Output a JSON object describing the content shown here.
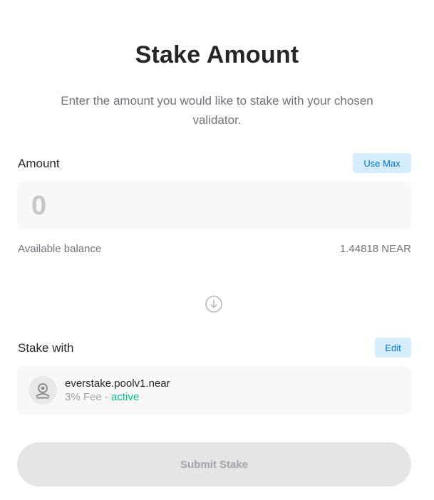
{
  "header": {
    "title": "Stake Amount",
    "subtitle": "Enter the amount you would like to stake with your chosen validator."
  },
  "amount": {
    "label": "Amount",
    "use_max_label": "Use Max",
    "placeholder": "0",
    "value": ""
  },
  "balance": {
    "label": "Available balance",
    "value": "1.44818 NEAR"
  },
  "icons": {
    "arrow": "arrow-down-circle-icon",
    "validator": "validator-avatar-icon"
  },
  "stake_with": {
    "label": "Stake with",
    "edit_label": "Edit",
    "validator": {
      "name": "everstake.poolv1.near",
      "fee": "3% Fee - ",
      "status": "active"
    }
  },
  "submit": {
    "label": "Submit Stake",
    "disabled": true
  },
  "colors": {
    "accent_bg": "#d6edff",
    "accent_text": "#0072ce",
    "status_active": "#00c08b",
    "disabled_button": "#e5e5e6"
  }
}
